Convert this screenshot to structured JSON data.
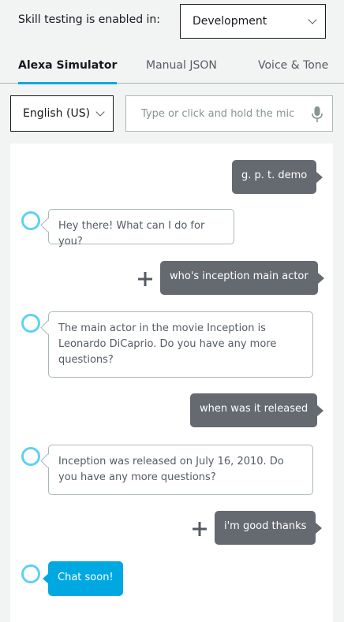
{
  "header": {
    "env_label": "Skill testing is enabled in:",
    "env_value": "Development"
  },
  "tabs": [
    {
      "label": "Alexa Simulator",
      "active": true
    },
    {
      "label": "Manual JSON",
      "active": false
    },
    {
      "label": "Voice & Tone",
      "active": false
    }
  ],
  "controls": {
    "language": "English (US)",
    "input_placeholder": "Type or click and hold the mic",
    "input_value": ""
  },
  "conversation": [
    {
      "speaker": "user",
      "text": "g. p. t. demo"
    },
    {
      "speaker": "alexa",
      "text": "Hey there! What can I do for you?"
    },
    {
      "speaker": "user",
      "text": "who's inception main actor"
    },
    {
      "speaker": "alexa",
      "text": "The main actor in the movie Inception is Leonardo DiCaprio. Do you have any more questions?"
    },
    {
      "speaker": "user",
      "text": "when was it released"
    },
    {
      "speaker": "alexa",
      "text": "Inception was released on July 16, 2010. Do you have any more questions?"
    },
    {
      "speaker": "user",
      "text": "i'm good thanks"
    },
    {
      "speaker": "alexa",
      "text": "Chat soon!"
    }
  ],
  "icons": {
    "env_select": "chevron-down-icon",
    "language_select": "chevron-down-icon",
    "input": "microphone-icon",
    "alexa_message": "alexa-ring-icon",
    "user_message_action": "plus-icon"
  },
  "colors": {
    "accent": "#00a8e1",
    "user_bubble": "#656970",
    "page_background": "#f2f3f3",
    "panel_background": "#ffffff"
  }
}
